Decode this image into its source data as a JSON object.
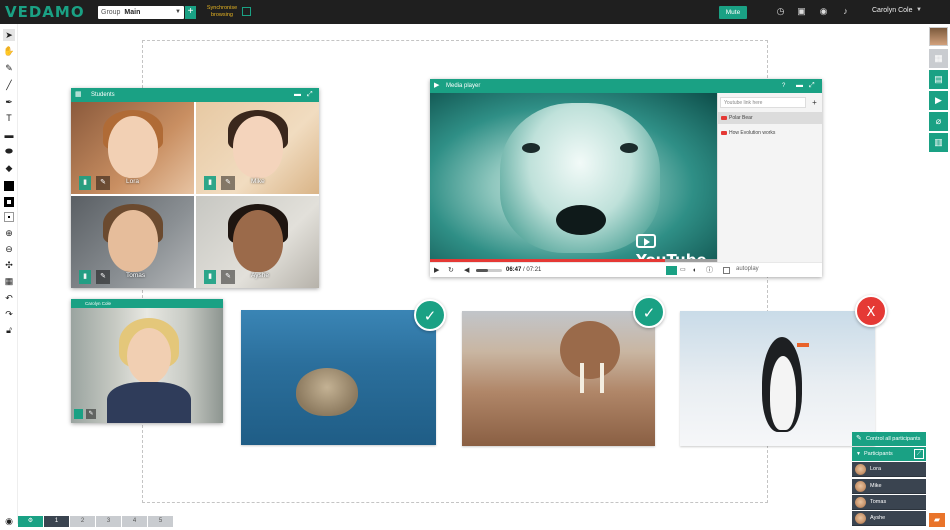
{
  "app": {
    "logo": "VEDAMO"
  },
  "topbar": {
    "group_prefix": "Group",
    "group_value": "Main",
    "sync_label": "Synchronise browsing",
    "mute_label": "Mute",
    "user_name": "Carolyn Cole"
  },
  "students_panel": {
    "title": "Students",
    "students": [
      {
        "name": "Lora"
      },
      {
        "name": "Mike"
      },
      {
        "name": "Tomas"
      },
      {
        "name": "Ayshe"
      }
    ]
  },
  "teacher_panel": {
    "title": "Carolyn Cole"
  },
  "media_player": {
    "title": "Media player",
    "help_label": "?",
    "search_placeholder": "Youtube link here",
    "playlist": [
      "Polar Bear",
      "How Evolution works"
    ],
    "time_current": "06:47",
    "time_total": "07:21",
    "progress": 0.82,
    "volume": 0.45,
    "autoplay_label": "autoplay",
    "watermark": "YouTube"
  },
  "participants": {
    "control_all_label": "Control all participants",
    "header_label": "Participants",
    "list": [
      "Lora",
      "Mike",
      "Tomas",
      "Ayshe"
    ]
  },
  "pages": [
    "1",
    "2",
    "3",
    "4",
    "5"
  ],
  "colors": {
    "accent": "#1aa184",
    "topbar": "#1f1f1f",
    "correct": "#1aa184",
    "wrong": "#e53935",
    "progress": "#e53935",
    "chat": "#e9742a"
  }
}
